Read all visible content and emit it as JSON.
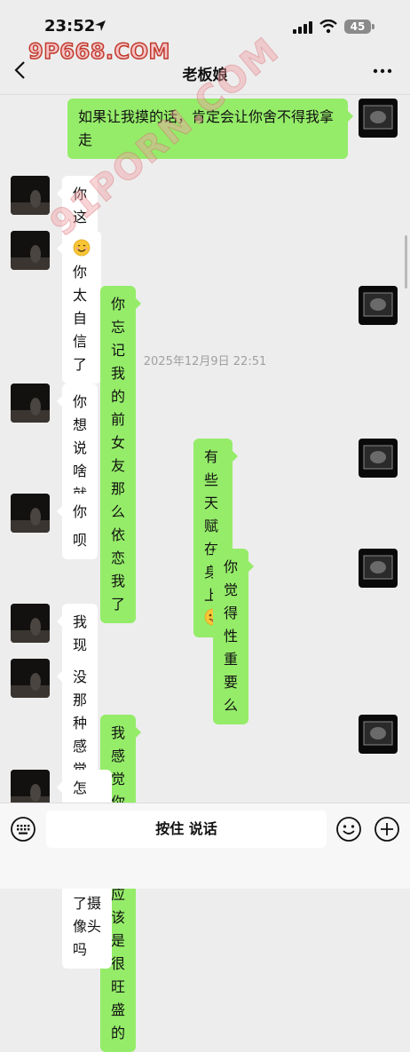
{
  "status": {
    "time": "23:52",
    "battery": "45"
  },
  "watermark_top": "9P668.COM",
  "watermark_diag": "91PORN.COM",
  "nav": {
    "title": "老板娘"
  },
  "messages": [
    {
      "side": "right",
      "text": "如果让我摸的话，肯定会让你舍不得我拿走"
    },
    {
      "side": "left",
      "text": "你这人"
    },
    {
      "side": "left",
      "text": "你太自信了",
      "emoji": "smiling-face-icon"
    },
    {
      "side": "right",
      "text": "你忘记我的前女友那么依恋我了"
    },
    {
      "side": "left",
      "text": "你想说啥就说呗"
    },
    {
      "side": "right",
      "text": "有些天赋在身上",
      "emoji": "winking-tongue-face-icon"
    },
    {
      "side": "left",
      "text": "你"
    },
    {
      "side": "right",
      "text": "你觉得性重要么"
    },
    {
      "side": "left",
      "text": "我现在太少了"
    },
    {
      "side": "left",
      "text": "没那种感觉了"
    },
    {
      "side": "right",
      "text": "我感觉你的性欲应该是很旺盛的"
    },
    {
      "side": "left",
      "text": "怎么，你在我身上按了摄像头吗"
    }
  ],
  "timestamp": "2025年12月9日 22:51",
  "input": {
    "hold_to_talk": "按住 说话"
  },
  "colors": {
    "right_bubble": "#95ec69",
    "left_bubble": "#ffffff",
    "background": "#ededed"
  }
}
